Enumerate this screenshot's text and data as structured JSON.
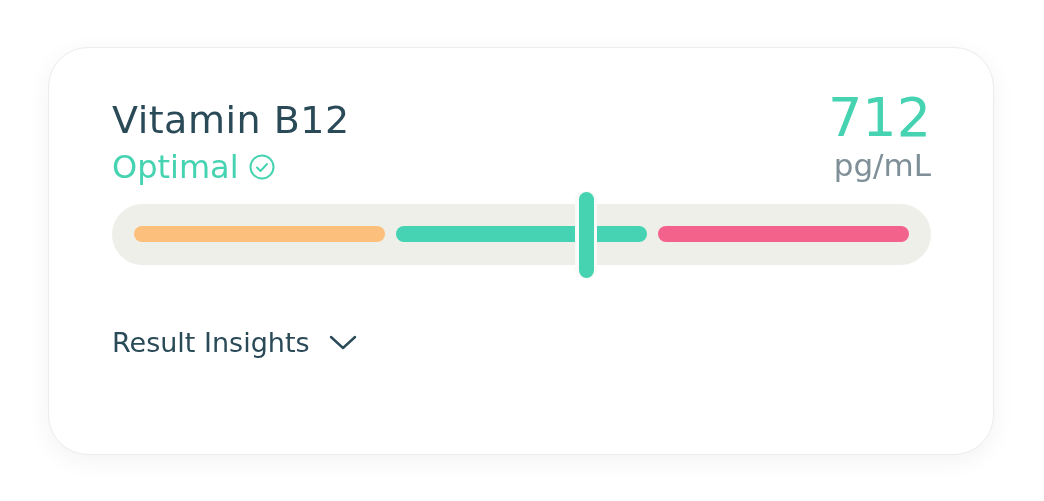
{
  "marker": {
    "name": "Vitamin B12",
    "status": "Optimal",
    "value": "712",
    "unit": "pg/mL"
  },
  "range": {
    "zones": [
      {
        "color": "#fdbf7c"
      },
      {
        "color": "#45d3b3"
      },
      {
        "color": "#f2628a"
      }
    ]
  },
  "insights": {
    "label": "Result Insights",
    "expanded": false
  }
}
